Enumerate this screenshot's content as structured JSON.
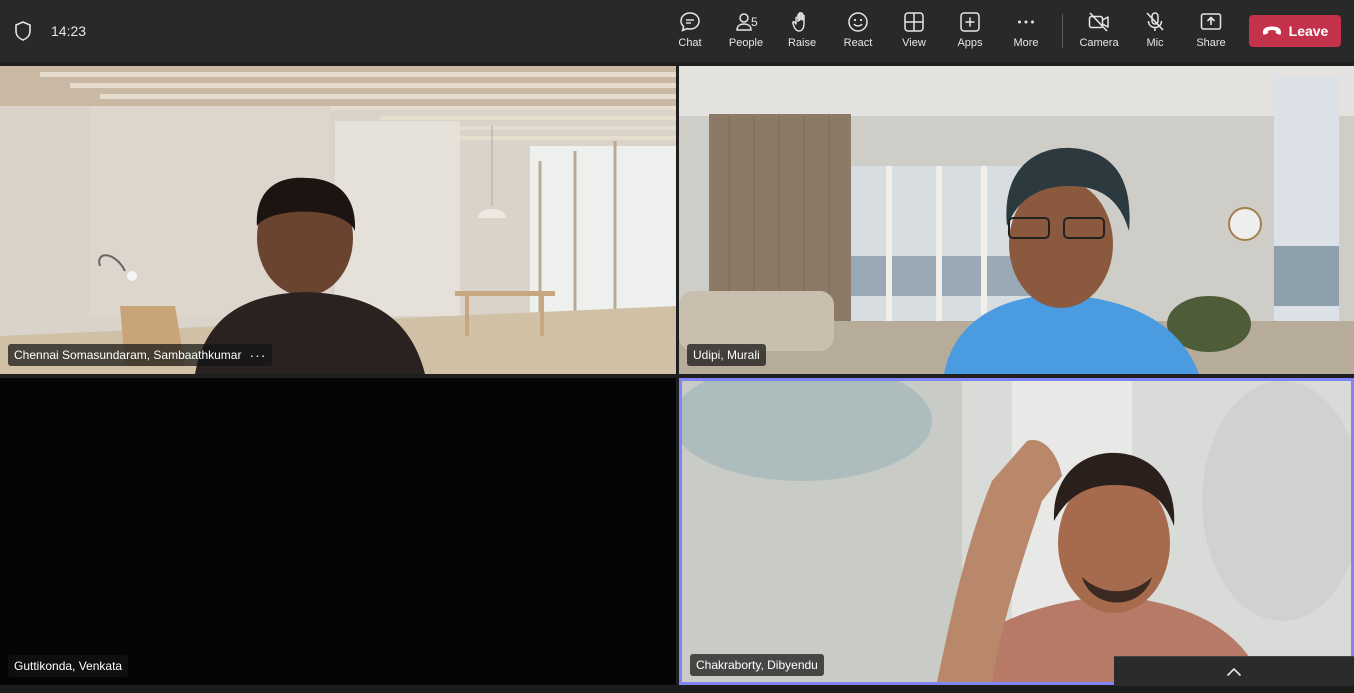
{
  "window": {
    "time": "14:23"
  },
  "toolbar": {
    "chat": "Chat",
    "people": "People",
    "people_count": "5",
    "raise": "Raise",
    "react": "React",
    "view": "View",
    "apps": "Apps",
    "more": "More",
    "camera": "Camera",
    "mic": "Mic",
    "share": "Share",
    "leave": "Leave"
  },
  "icons": {
    "shield": "shield-icon",
    "chat": "chat-icon",
    "people": "people-icon",
    "raise": "hand-icon",
    "react": "smiley-icon",
    "view": "grid-icon",
    "apps": "plus-icon",
    "more": "ellipsis-icon",
    "camera": "camera-off-icon",
    "mic": "mic-off-icon",
    "share": "share-icon",
    "leave": "phone-hangup-icon",
    "collapse": "chevron-up-icon"
  },
  "colors": {
    "leave": "#c4314b",
    "active_speaker_border": "#7f85f5",
    "toolbar_bg": "#292929"
  },
  "participants": [
    {
      "name": "Chennai Somasundaram, Sambaathkumar",
      "more": "···"
    },
    {
      "name": "Udipi, Murali"
    },
    {
      "name": "Guttikonda, Venkata"
    },
    {
      "name": "Chakraborty, Dibyendu"
    }
  ]
}
